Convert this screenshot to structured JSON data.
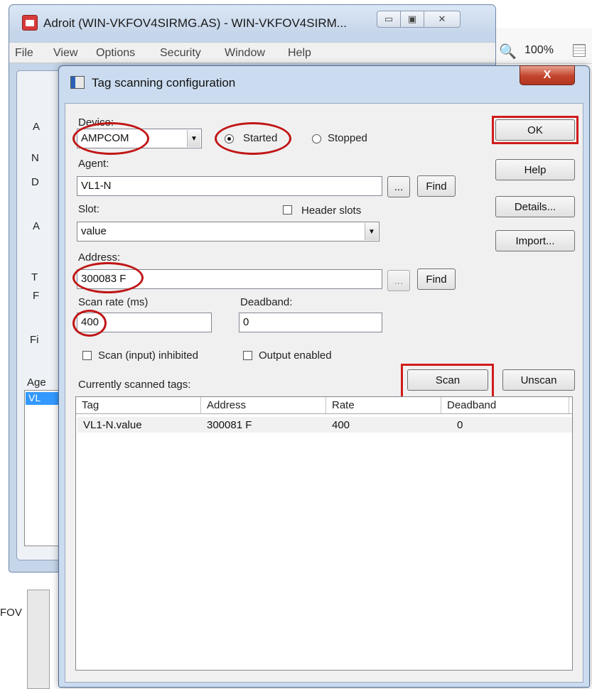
{
  "background_window": {
    "title": "Adroit (WIN-VKFOV4SIRMG.AS) - WIN-VKFOV4SIRM...",
    "menu": [
      "File",
      "View",
      "Options",
      "Security",
      "Window",
      "Help"
    ],
    "zoom": "100%",
    "stubs": [
      "A",
      "N",
      "D",
      "A",
      "T",
      "F",
      "Fi",
      "Age",
      "VL"
    ],
    "left_text": "FOV"
  },
  "dialog": {
    "title": "Tag scanning configuration",
    "close_glyph": "X",
    "device": {
      "label": "Device:",
      "value": "AMPCOM"
    },
    "state": {
      "started_label": "Started",
      "stopped_label": "Stopped",
      "selected": "Started"
    },
    "agent": {
      "label": "Agent:",
      "value": "VL1-N",
      "browse_label": "...",
      "find_label": "Find"
    },
    "slot": {
      "label": "Slot:",
      "value": "value",
      "header_slots_label": "Header slots",
      "header_slots_checked": false
    },
    "address": {
      "label": "Address:",
      "value": "300083 F",
      "browse_label": "...",
      "find_label": "Find"
    },
    "scan_rate": {
      "label": "Scan rate (ms)",
      "value": "400"
    },
    "deadband": {
      "label": "Deadband:",
      "value": "0"
    },
    "scan_inhibited": {
      "label": "Scan (input) inhibited",
      "checked": false
    },
    "output_enabled": {
      "label": "Output enabled",
      "checked": false
    },
    "buttons": {
      "ok": "OK",
      "help": "Help",
      "details": "Details...",
      "import": "Import...",
      "scan": "Scan",
      "unscan": "Unscan"
    },
    "scanned_tags": {
      "label": "Currently scanned tags:",
      "columns": [
        "Tag",
        "Address",
        "Rate",
        "Deadband"
      ],
      "rows": [
        [
          "VL1-N.value",
          "300081 F",
          "400",
          "0"
        ]
      ]
    }
  },
  "colors": {
    "highlight": "#c01616",
    "dialog_frame": "#cbdcf0",
    "close_button": "#c2432b"
  }
}
